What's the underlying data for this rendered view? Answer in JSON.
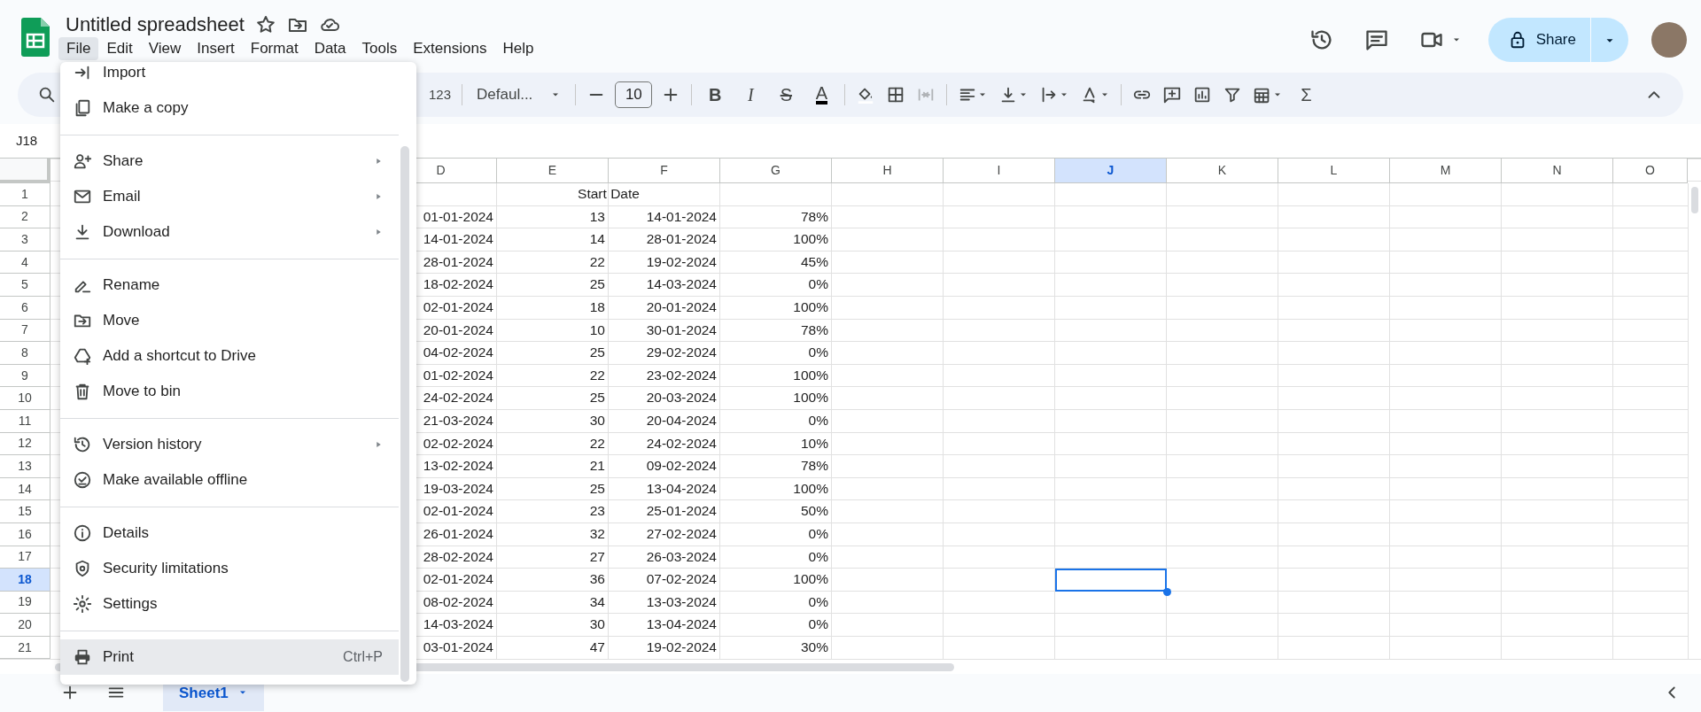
{
  "doc": {
    "title": "Untitled spreadsheet"
  },
  "menu_bar": [
    {
      "label": "File",
      "selected": true
    },
    {
      "label": "Edit",
      "selected": false
    },
    {
      "label": "View",
      "selected": false
    },
    {
      "label": "Insert",
      "selected": false
    },
    {
      "label": "Format",
      "selected": false
    },
    {
      "label": "Data",
      "selected": false
    },
    {
      "label": "Tools",
      "selected": false
    },
    {
      "label": "Extensions",
      "selected": false
    },
    {
      "label": "Help",
      "selected": false
    }
  ],
  "share_button": {
    "label": "Share"
  },
  "toolbar": {
    "number_format": "123",
    "font": "Defaul...",
    "font_size": "10",
    "text_style_buttons": [
      {
        "label": "B",
        "kind": "bold"
      },
      {
        "label": "I",
        "kind": "italic"
      },
      {
        "label": "S",
        "kind": "strike"
      },
      {
        "label": "A",
        "kind": "color"
      }
    ],
    "functions_button": {
      "label": "Σ"
    }
  },
  "name_box": "J18",
  "sheet": {
    "columns": [
      {
        "label": "D",
        "selected": false
      },
      {
        "label": "E",
        "selected": false
      },
      {
        "label": "F",
        "selected": false
      },
      {
        "label": "G",
        "selected": false
      },
      {
        "label": "H",
        "selected": false
      },
      {
        "label": "I",
        "selected": false
      },
      {
        "label": "J",
        "selected": true
      },
      {
        "label": "K",
        "selected": false
      },
      {
        "label": "L",
        "selected": false
      },
      {
        "label": "M",
        "selected": false
      },
      {
        "label": "N",
        "selected": false
      },
      {
        "label": "O",
        "selected": false
      }
    ],
    "rows": [
      {
        "number": "1",
        "selected": false,
        "kind": "heading",
        "text": "Start Date"
      },
      {
        "number": "2",
        "selected": false,
        "kind": "data",
        "cells": [
          "01-01-2024",
          "13",
          "14-01-2024",
          "78%"
        ]
      },
      {
        "number": "3",
        "selected": false,
        "kind": "data",
        "cells": [
          "14-01-2024",
          "14",
          "28-01-2024",
          "100%"
        ]
      },
      {
        "number": "4",
        "selected": false,
        "kind": "data",
        "cells": [
          "28-01-2024",
          "22",
          "19-02-2024",
          "45%"
        ]
      },
      {
        "number": "5",
        "selected": false,
        "kind": "data",
        "cells": [
          "18-02-2024",
          "25",
          "14-03-2024",
          "0%"
        ]
      },
      {
        "number": "6",
        "selected": false,
        "kind": "data",
        "cells": [
          "02-01-2024",
          "18",
          "20-01-2024",
          "100%"
        ]
      },
      {
        "number": "7",
        "selected": false,
        "kind": "data",
        "cells": [
          "20-01-2024",
          "10",
          "30-01-2024",
          "78%"
        ]
      },
      {
        "number": "8",
        "selected": false,
        "kind": "data",
        "cells": [
          "04-02-2024",
          "25",
          "29-02-2024",
          "0%"
        ]
      },
      {
        "number": "9",
        "selected": false,
        "kind": "data",
        "cells": [
          "01-02-2024",
          "22",
          "23-02-2024",
          "100%"
        ]
      },
      {
        "number": "10",
        "selected": false,
        "kind": "data",
        "cells": [
          "24-02-2024",
          "25",
          "20-03-2024",
          "100%"
        ]
      },
      {
        "number": "11",
        "selected": false,
        "kind": "data",
        "cells": [
          "21-03-2024",
          "30",
          "20-04-2024",
          "0%"
        ]
      },
      {
        "number": "12",
        "selected": false,
        "kind": "data",
        "cells": [
          "02-02-2024",
          "22",
          "24-02-2024",
          "10%"
        ]
      },
      {
        "number": "13",
        "selected": false,
        "kind": "data",
        "cells": [
          "13-02-2024",
          "21",
          "09-02-2024",
          "78%"
        ]
      },
      {
        "number": "14",
        "selected": false,
        "kind": "data",
        "cells": [
          "19-03-2024",
          "25",
          "13-04-2024",
          "100%"
        ]
      },
      {
        "number": "15",
        "selected": false,
        "kind": "data",
        "cells": [
          "02-01-2024",
          "23",
          "25-01-2024",
          "50%"
        ]
      },
      {
        "number": "16",
        "selected": false,
        "kind": "data",
        "cells": [
          "26-01-2024",
          "32",
          "27-02-2024",
          "0%"
        ]
      },
      {
        "number": "17",
        "selected": false,
        "kind": "data",
        "cells": [
          "28-02-2024",
          "27",
          "26-03-2024",
          "0%"
        ]
      },
      {
        "number": "18",
        "selected": true,
        "kind": "data",
        "cells": [
          "02-01-2024",
          "36",
          "07-02-2024",
          "100%"
        ]
      },
      {
        "number": "19",
        "selected": false,
        "kind": "data",
        "cells": [
          "08-02-2024",
          "34",
          "13-03-2024",
          "0%"
        ]
      },
      {
        "number": "20",
        "selected": false,
        "kind": "data",
        "cells": [
          "14-03-2024",
          "30",
          "13-04-2024",
          "0%"
        ]
      },
      {
        "number": "21",
        "selected": false,
        "kind": "data",
        "cells": [
          "03-01-2024",
          "47",
          "19-02-2024",
          "30%"
        ]
      }
    ]
  },
  "file_menu": {
    "items": [
      {
        "kind": "item",
        "label": "Import",
        "submenu": false,
        "highlighted": false
      },
      {
        "kind": "item",
        "label": "Make a copy",
        "submenu": false,
        "highlighted": false
      },
      {
        "kind": "divider"
      },
      {
        "kind": "item",
        "label": "Share",
        "submenu": true,
        "highlighted": false
      },
      {
        "kind": "item",
        "label": "Email",
        "submenu": true,
        "highlighted": false
      },
      {
        "kind": "item",
        "label": "Download",
        "submenu": true,
        "highlighted": false
      },
      {
        "kind": "divider"
      },
      {
        "kind": "item",
        "label": "Rename",
        "submenu": false,
        "highlighted": false
      },
      {
        "kind": "item",
        "label": "Move",
        "submenu": false,
        "highlighted": false
      },
      {
        "kind": "item",
        "label": "Add a shortcut to Drive",
        "submenu": false,
        "highlighted": false
      },
      {
        "kind": "item",
        "label": "Move to bin",
        "submenu": false,
        "highlighted": false
      },
      {
        "kind": "divider"
      },
      {
        "kind": "item",
        "label": "Version history",
        "submenu": true,
        "highlighted": false
      },
      {
        "kind": "item",
        "label": "Make available offline",
        "submenu": false,
        "highlighted": false
      },
      {
        "kind": "divider"
      },
      {
        "kind": "item",
        "label": "Details",
        "submenu": false,
        "highlighted": false
      },
      {
        "kind": "item",
        "label": "Security limitations",
        "submenu": false,
        "highlighted": false
      },
      {
        "kind": "item",
        "label": "Settings",
        "submenu": false,
        "highlighted": false
      },
      {
        "kind": "divider"
      },
      {
        "kind": "item",
        "label": "Print",
        "shortcut": "Ctrl+P",
        "submenu": false,
        "highlighted": true
      }
    ]
  },
  "sheet_tabs": [
    {
      "label": "Sheet1",
      "selected": true
    }
  ]
}
